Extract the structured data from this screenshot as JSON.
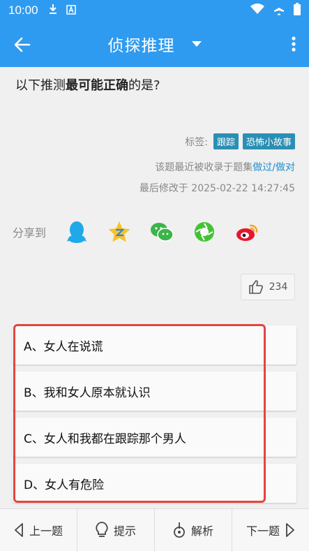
{
  "status_bar": {
    "time": "10:00"
  },
  "app_bar": {
    "title": "侦探推理"
  },
  "question": {
    "prefix": "以下推测",
    "emphasis": "最可能正确",
    "suffix": "的是?"
  },
  "meta": {
    "tags_label": "标签:",
    "tags": [
      "跟踪",
      "恐怖小故事"
    ],
    "collected_prefix": "该题最近被收录于题集",
    "collected_link": "做过/做对",
    "modified": "最后修改于 2025-02-22 14:27:45"
  },
  "share": {
    "label": "分享到"
  },
  "like": {
    "count": "234"
  },
  "options": [
    {
      "label": "A、女人在说谎"
    },
    {
      "label": "B、我和女人原本就认识"
    },
    {
      "label": "C、女人和我都在跟踪那个男人"
    },
    {
      "label": "D、女人有危险"
    }
  ],
  "bottom_bar": {
    "prev": "上一题",
    "hint": "提示",
    "analysis": "解析",
    "next": "下一题"
  },
  "colors": {
    "primary": "#2f9bf0",
    "tag": "#2a8fb4",
    "link": "#1f8fd0",
    "highlight": "#e0473f"
  }
}
